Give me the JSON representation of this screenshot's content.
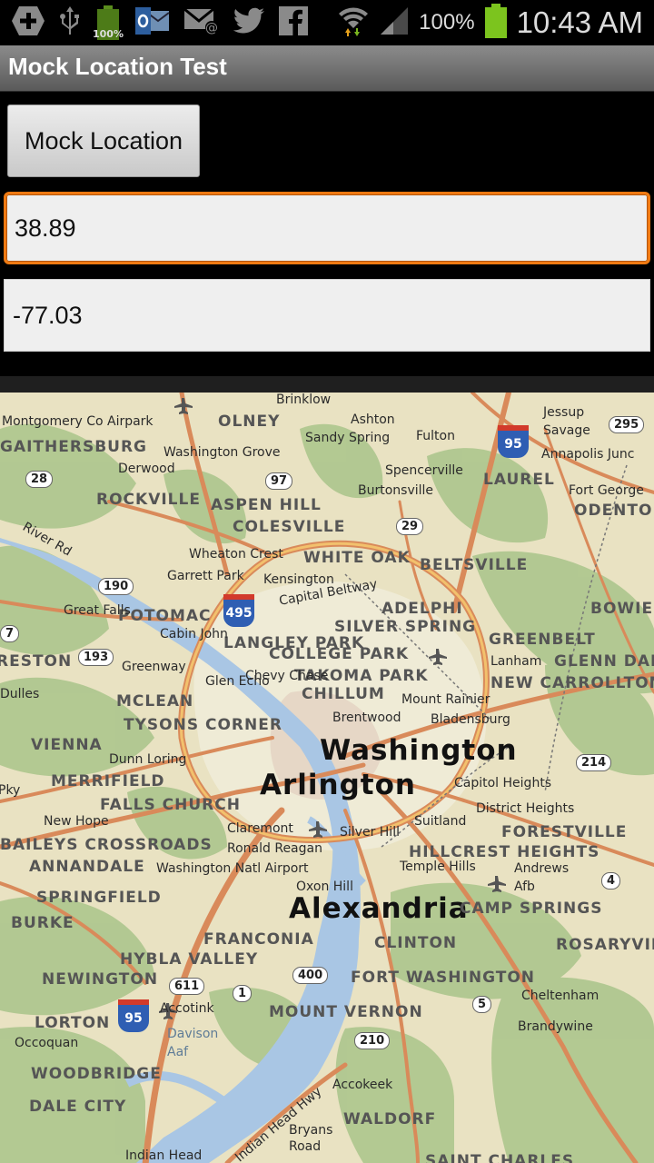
{
  "status_bar": {
    "battery_small_label": "100%",
    "battery_pct": "100%",
    "time": "10:43 AM",
    "icons": [
      "add-icon",
      "usb-icon",
      "battery-full-icon",
      "outlook-icon",
      "email-icon",
      "twitter-icon",
      "facebook-icon",
      "wifi-icon",
      "signal-icon",
      "battery-icon"
    ]
  },
  "title_bar": {
    "title": "Mock Location Test"
  },
  "controls": {
    "mock_button_label": "Mock Location",
    "latitude_value": "38.89",
    "longitude_value": "-77.03"
  },
  "map": {
    "major_labels": [
      "Washington",
      "Arlington",
      "Alexandria"
    ],
    "town_labels": [
      "OLNEY",
      "GAITHERSBURG",
      "ROCKVILLE",
      "ASPEN HILL",
      "COLESVILLE",
      "WHITE OAK",
      "BELTSVILLE",
      "LAUREL",
      "POTOMAC",
      "ADELPHI",
      "SILVER SPRING",
      "GREENBELT",
      "BOWIE",
      "LANGLEY PARK",
      "COLLEGE PARK",
      "TAKOMA PARK",
      "CHILLUM",
      "MCLEAN",
      "TYSONS CORNER",
      "GLENN DALE",
      "NEW CARROLLTON",
      "VIENNA",
      "MERRIFIELD",
      "FALLS CHURCH",
      "BAILEYS CROSSROADS",
      "ANNANDALE",
      "HILLCREST HEIGHTS",
      "FORESTVILLE",
      "SPRINGFIELD",
      "FRANCONIA",
      "CLINTON",
      "CAMP SPRINGS",
      "BURKE",
      "HYBLA VALLEY",
      "NEWINGTON",
      "FORT WASHINGTON",
      "ROSARYVILLE",
      "LORTON",
      "MOUNT VERNON",
      "WOODBRIDGE",
      "DALE CITY",
      "WALDORF",
      "ODENTON",
      "SAINT CHARLES",
      "RESTON"
    ],
    "place_labels": [
      "Montgomery Co Airpark",
      "Brinklow",
      "Ashton",
      "Sandy Spring",
      "Fulton",
      "Jessup",
      "Savage",
      "Annapolis Junc",
      "Washington Grove",
      "Derwood",
      "Spencerville",
      "Burtonsville",
      "Fort George",
      "River Rd",
      "Wheaton Crest",
      "Garrett Park",
      "Kensington",
      "Capital Beltway",
      "Great Falls",
      "Cabin John",
      "Greenway",
      "Glen Echo",
      "Chevy Chase",
      "Mount Rainier",
      "Brentwood",
      "Bladensburg",
      "Lanham",
      "Dulles",
      "Dunn Loring",
      "Capitol Heights",
      "District Heights",
      "New Hope",
      "Claremont",
      "Ronald Reagan",
      "Washington Natl Airport",
      "Silver Hill",
      "Suitland",
      "Temple Hills",
      "Andrews",
      "Afb",
      "Oxon Hill",
      "Accotink",
      "Davison",
      "Aaf",
      "Cheltenham",
      "Brandywine",
      "Occoquan",
      "Accokeek",
      "Indian Head Hwy",
      "Bryans",
      "Road",
      "Indian Head",
      "Pky"
    ],
    "route_shields": [
      "295",
      "28",
      "97",
      "29",
      "190",
      "193",
      "214",
      "4",
      "611",
      "1",
      "400",
      "5",
      "210",
      "7"
    ],
    "interstate_shields": [
      "95",
      "495",
      "95"
    ]
  }
}
